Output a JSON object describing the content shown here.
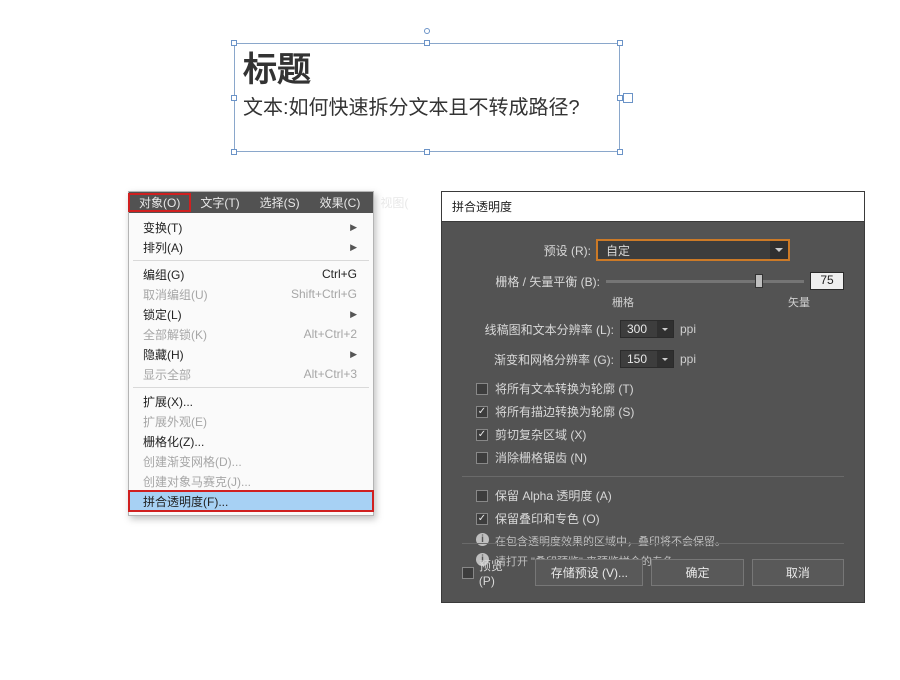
{
  "textframe": {
    "title": "标题",
    "body": "文本:如何快速拆分文本且不转成路径?"
  },
  "menubar": {
    "items": [
      "对象(O)",
      "文字(T)",
      "选择(S)",
      "效果(C)",
      "视图("
    ],
    "active_index": 0
  },
  "menu": {
    "groups": [
      [
        {
          "label": "变换(T)",
          "shortcut": "",
          "arrow": true,
          "enabled": true
        },
        {
          "label": "排列(A)",
          "shortcut": "",
          "arrow": true,
          "enabled": true
        }
      ],
      [
        {
          "label": "编组(G)",
          "shortcut": "Ctrl+G",
          "arrow": false,
          "enabled": true
        },
        {
          "label": "取消编组(U)",
          "shortcut": "Shift+Ctrl+G",
          "arrow": false,
          "enabled": false
        },
        {
          "label": "锁定(L)",
          "shortcut": "",
          "arrow": true,
          "enabled": true
        },
        {
          "label": "全部解锁(K)",
          "shortcut": "Alt+Ctrl+2",
          "arrow": false,
          "enabled": false
        },
        {
          "label": "隐藏(H)",
          "shortcut": "",
          "arrow": true,
          "enabled": true
        },
        {
          "label": "显示全部",
          "shortcut": "Alt+Ctrl+3",
          "arrow": false,
          "enabled": false
        }
      ],
      [
        {
          "label": "扩展(X)...",
          "shortcut": "",
          "arrow": false,
          "enabled": true
        },
        {
          "label": "扩展外观(E)",
          "shortcut": "",
          "arrow": false,
          "enabled": false
        },
        {
          "label": "栅格化(Z)...",
          "shortcut": "",
          "arrow": false,
          "enabled": true
        },
        {
          "label": "创建渐变网格(D)...",
          "shortcut": "",
          "arrow": false,
          "enabled": false
        },
        {
          "label": "创建对象马赛克(J)...",
          "shortcut": "",
          "arrow": false,
          "enabled": false
        },
        {
          "label": "拼合透明度(F)...",
          "shortcut": "",
          "arrow": false,
          "enabled": true,
          "highlight": true
        }
      ]
    ]
  },
  "dialog": {
    "title": "拼合透明度",
    "preset_label": "预设 (R):",
    "preset_value": "自定",
    "balance_label": "栅格 / 矢量平衡 (B):",
    "balance_value": "75",
    "balance_left": "栅格",
    "balance_right": "矢量",
    "res_line_label": "线稿图和文本分辨率 (L):",
    "res_line_value": "300",
    "res_grad_label": "渐变和网格分辨率 (G):",
    "res_grad_value": "150",
    "ppi": "ppi",
    "cb_text_outline": "将所有文本转换为轮廓 (T)",
    "cb_stroke_outline": "将所有描边转换为轮廓 (S)",
    "cb_clip": "剪切复杂区域 (X)",
    "cb_antialias": "消除栅格锯齿 (N)",
    "cb_alpha": "保留 Alpha 透明度 (A)",
    "cb_overprint": "保留叠印和专色 (O)",
    "info1": "在包含透明度效果的区域中，叠印将不会保留。",
    "info2": "请打开 \"叠印预览\" 来预览拼合的专色。",
    "cb_preview": "预览 (P)",
    "btn_save": "存储预设 (V)...",
    "btn_ok": "确定",
    "btn_cancel": "取消"
  }
}
